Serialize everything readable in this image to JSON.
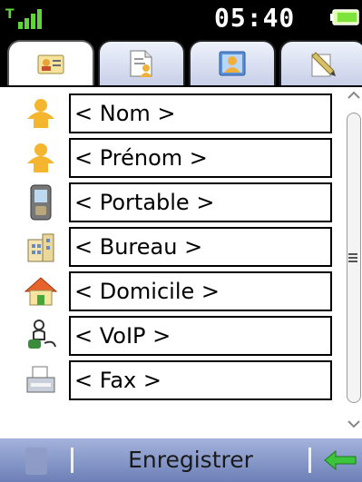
{
  "status": {
    "time": "05:40"
  },
  "tabs": [
    {
      "icon": "contact-card-icon",
      "active": true
    },
    {
      "icon": "document-person-icon",
      "active": false
    },
    {
      "icon": "person-photo-icon",
      "active": false
    },
    {
      "icon": "note-pencil-icon",
      "active": false
    }
  ],
  "fields": [
    {
      "icon": "person-icon",
      "label": "< Nom >"
    },
    {
      "icon": "person-icon",
      "label": "< Prénom >"
    },
    {
      "icon": "mobile-phone-icon",
      "label": "< Portable >"
    },
    {
      "icon": "office-building-icon",
      "label": "< Bureau >"
    },
    {
      "icon": "home-icon",
      "label": "< Domicile >"
    },
    {
      "icon": "voip-icon",
      "label": "< VoIP >"
    },
    {
      "icon": "fax-icon",
      "label": "< Fax >"
    }
  ],
  "bottom": {
    "save_label": "Enregistrer"
  },
  "colors": {
    "accent": "#7a8cc4",
    "back_arrow": "#3cc43c"
  }
}
